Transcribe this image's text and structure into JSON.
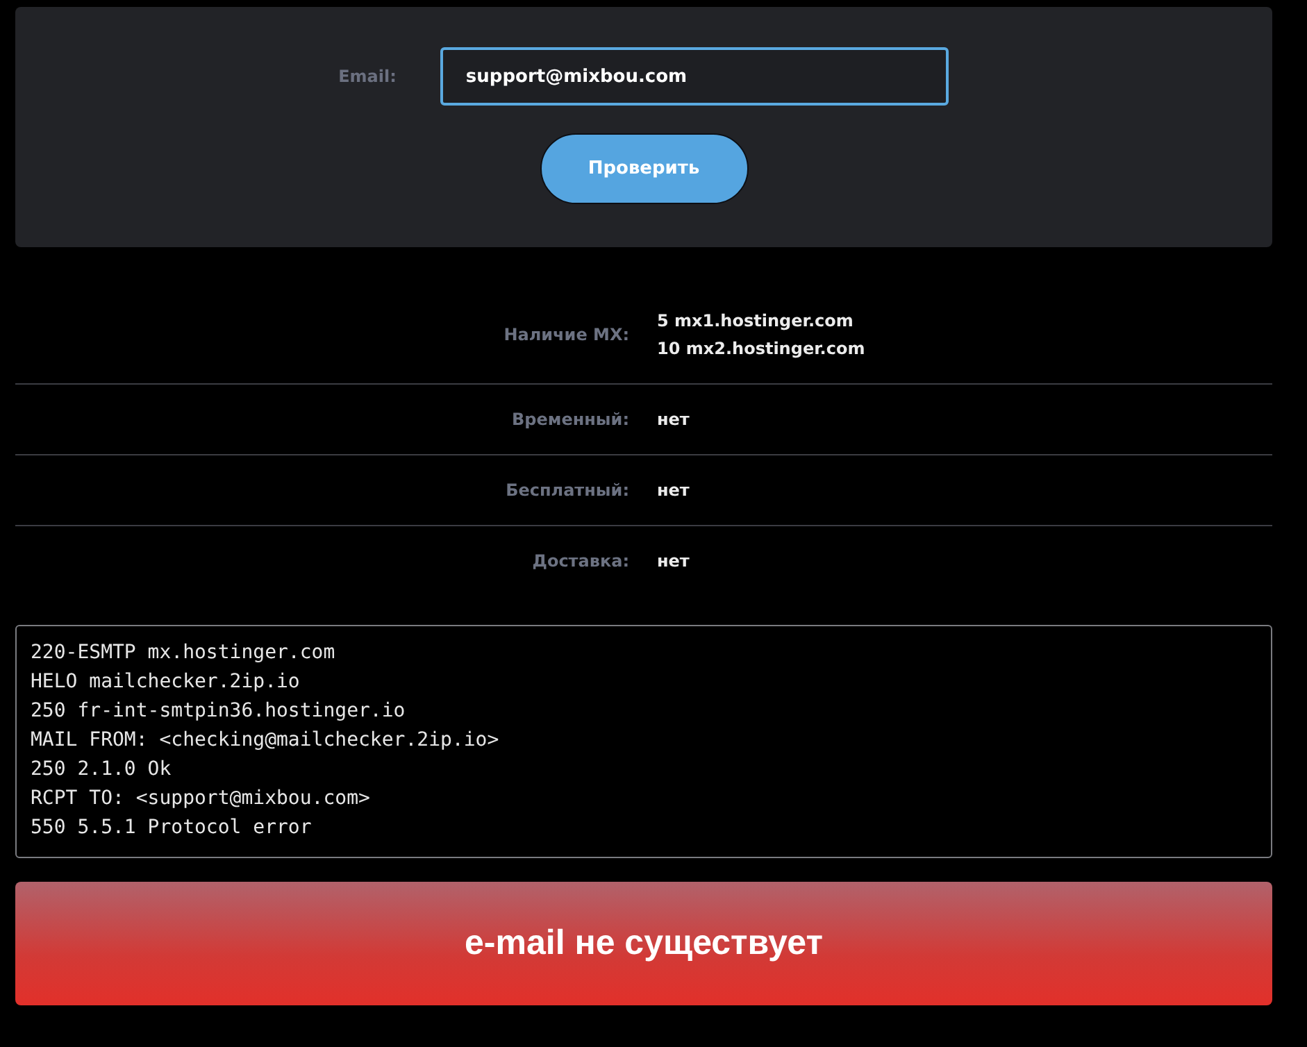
{
  "form": {
    "label": "Email:",
    "input": {
      "value": "support@mixbou.com",
      "focused": true
    },
    "button": "Проверить"
  },
  "results": [
    {
      "label": "Наличие MX:",
      "values": [
        "5 mx1.hostinger.com",
        "10 mx2.hostinger.com"
      ]
    },
    {
      "label": "Временный:",
      "values": [
        "нет"
      ]
    },
    {
      "label": "Бесплатный:",
      "values": [
        "нет"
      ]
    },
    {
      "label": "Доставка:",
      "values": [
        "нет"
      ]
    }
  ],
  "log": [
    "220-ESMTP mx.hostinger.com",
    "HELO mailchecker.2ip.io",
    "250 fr-int-smtpin36.hostinger.io",
    "MAIL FROM: <checking@mailchecker.2ip.io>",
    "250 2.1.0 Ok",
    "RCPT TO: <support@mixbou.com>",
    "550 5.5.1 Protocol error"
  ],
  "verdict": {
    "kind": "error",
    "text": "e-mail не существует"
  }
}
